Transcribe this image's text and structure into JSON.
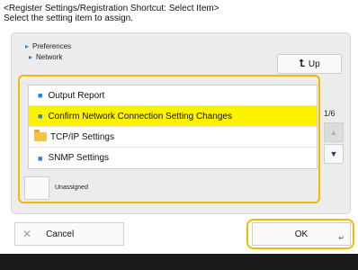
{
  "header": {
    "title": "<Register Settings/Registration Shortcut: Select Item>",
    "instruction": "Select the setting item to assign."
  },
  "breadcrumb": {
    "level1": "Preferences",
    "level2": "Network"
  },
  "up_button": {
    "label": "Up",
    "icon": "up-arrow-icon"
  },
  "list": {
    "items": [
      {
        "label": "Output Report",
        "type": "setting",
        "selected": false
      },
      {
        "label": "Confirm Network Connection Setting Changes",
        "type": "setting",
        "selected": true
      },
      {
        "label": "TCP/IP Settings",
        "type": "folder",
        "selected": false
      },
      {
        "label": "SNMP Settings",
        "type": "setting",
        "selected": false
      }
    ]
  },
  "pagination": {
    "text": "1/6"
  },
  "unassigned": {
    "label": "Unassigned"
  },
  "footer": {
    "cancel_label": "Cancel",
    "ok_label": "OK"
  },
  "colors": {
    "highlight": "#f5b800",
    "selected_row": "#fff200",
    "bullet": "#2a7fd4"
  }
}
